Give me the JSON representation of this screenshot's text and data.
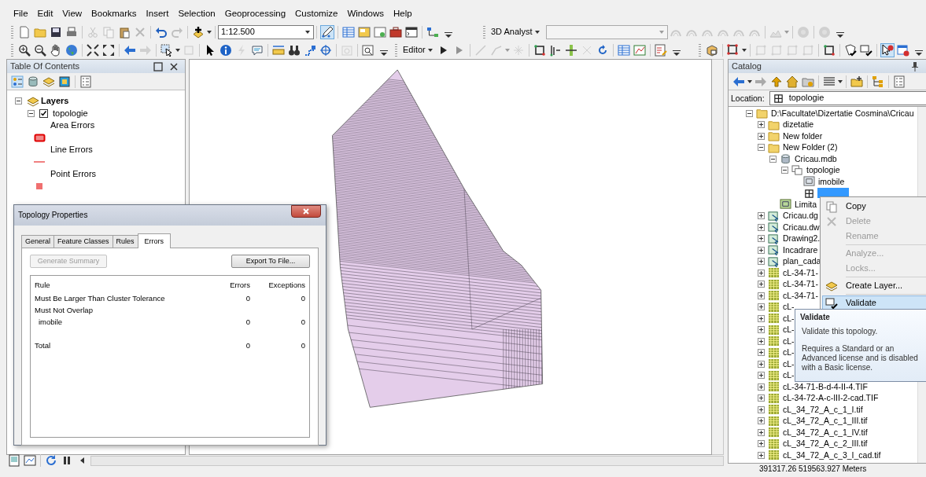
{
  "menu": [
    {
      "label": "File"
    },
    {
      "label": "Edit"
    },
    {
      "label": "View"
    },
    {
      "label": "Bookmarks"
    },
    {
      "label": "Insert"
    },
    {
      "label": "Selection"
    },
    {
      "label": "Geoprocessing"
    },
    {
      "label": "Customize"
    },
    {
      "label": "Windows"
    },
    {
      "label": "Help"
    }
  ],
  "toolbar": {
    "scale": "1:12.500",
    "analyst_label": "3D Analyst",
    "editor_label": "Editor"
  },
  "toc": {
    "title": "Table Of Contents",
    "tree": [
      {
        "label": "Layers",
        "kind": "frame",
        "expanded": true,
        "children": [
          {
            "label": "topologie",
            "kind": "layer",
            "expanded": true,
            "checked": true,
            "children": [
              {
                "label": "Area Errors",
                "kind": "area"
              },
              {
                "label": "Line Errors",
                "kind": "line"
              },
              {
                "label": "Point Errors",
                "kind": "point"
              }
            ]
          }
        ]
      }
    ]
  },
  "dialog": {
    "title": "Topology Properties",
    "tabs": [
      {
        "label": "General",
        "selected": false
      },
      {
        "label": "Feature Classes",
        "selected": false
      },
      {
        "label": "Rules",
        "selected": false
      },
      {
        "label": "Errors",
        "selected": true
      }
    ],
    "buttons": [
      {
        "label": "Generate Summary",
        "disabled": true
      },
      {
        "label": "Export To File...",
        "disabled": false
      }
    ],
    "table": {
      "columns": [
        "Rule",
        "Errors",
        "Exceptions"
      ],
      "rows": [
        {
          "kind": "rule",
          "rule": "Must Be Larger Than Cluster Tolerance",
          "errors": "0",
          "exceptions": "0"
        },
        {
          "kind": "rule",
          "rule": "Must Not Overlap"
        },
        {
          "kind": "feature",
          "rule": "imobile",
          "errors": "0",
          "exceptions": "0"
        },
        {
          "kind": "total",
          "rule": "Total",
          "errors": "0",
          "exceptions": "0"
        }
      ]
    }
  },
  "catalog": {
    "title": "Catalog",
    "location_label": "Location:",
    "location_value": "topologie",
    "tree": [
      {
        "label": "D:\\Facultate\\Dizertatie Cosmina\\Cricau",
        "kind": "folder",
        "expanded": true,
        "selected": false,
        "children": [
          {
            "label": "dizetatie",
            "kind": "folder",
            "expanded": false,
            "selected": false
          },
          {
            "label": "New folder",
            "kind": "folder",
            "expanded": false,
            "selected": false
          },
          {
            "label": "New Folder (2)",
            "kind": "folder",
            "expanded": true,
            "selected": false,
            "children": [
              {
                "label": "Cricau.mdb",
                "kind": "database",
                "expanded": true,
                "selected": false,
                "children": [
                  {
                    "label": "topologie",
                    "kind": "dataset",
                    "expanded": true,
                    "selected": false,
                    "children": [
                      {
                        "label": "imobile",
                        "kind": "feature_class",
                        "selected": false
                      },
                      {
                        "kind": "topology",
                        "selected": true
                      }
                    ]
                  }
                ]
              },
              {
                "label": "Limita",
                "kind": "shapefile",
                "selected": false
              }
            ]
          },
          {
            "label": "Cricau.dg",
            "kind": "cad",
            "expanded": false,
            "selected": false
          },
          {
            "label": "Cricau.dw",
            "kind": "cad",
            "expanded": false,
            "selected": false
          },
          {
            "label": "Drawing2.",
            "kind": "cad",
            "expanded": false,
            "selected": false
          },
          {
            "label": "Incadrare",
            "kind": "cad",
            "expanded": false,
            "selected": false
          },
          {
            "label": "plan_cada",
            "kind": "cad",
            "expanded": false,
            "selected": false
          },
          {
            "label": "cL-34-71-",
            "kind": "raster",
            "expanded": false,
            "selected": false
          },
          {
            "label": "cL-34-71-",
            "kind": "raster",
            "expanded": false,
            "selected": false
          },
          {
            "label": "cL-34-71-",
            "kind": "raster",
            "expanded": false,
            "selected": false
          },
          {
            "label": "cL-",
            "kind": "raster",
            "expanded": false,
            "selected": false
          },
          {
            "label": "cL-",
            "kind": "raster",
            "expanded": false,
            "selected": false
          },
          {
            "label": "cL-",
            "kind": "raster",
            "expanded": false,
            "selected": false
          },
          {
            "label": "cL-",
            "kind": "raster",
            "expanded": false,
            "selected": false
          },
          {
            "label": "cL-",
            "kind": "raster",
            "expanded": false,
            "selected": false
          },
          {
            "label": "cL-",
            "kind": "raster",
            "expanded": false,
            "selected": false
          },
          {
            "label": "cL-",
            "kind": "raster",
            "expanded": false,
            "selected": false
          },
          {
            "label": "cL-34-71-B-d-4-II-4.TIF",
            "kind": "raster",
            "expanded": false,
            "selected": false
          },
          {
            "label": "cL-34-72-A-c-III-2-cad.TIF",
            "kind": "raster",
            "expanded": false,
            "selected": false
          },
          {
            "label": "cL_34_72_A_c_1_I.tif",
            "kind": "raster",
            "expanded": false,
            "selected": false
          },
          {
            "label": "cL_34_72_A_c_1_III.tif",
            "kind": "raster",
            "expanded": false,
            "selected": false
          },
          {
            "label": "cL_34_72_A_c_1_IV.tif",
            "kind": "raster",
            "expanded": false,
            "selected": false
          },
          {
            "label": "cL_34_72_A_c_2_III.tif",
            "kind": "raster",
            "expanded": false,
            "selected": false
          },
          {
            "label": "cL_34_72_A_c_3_I_cad.tif",
            "kind": "raster",
            "expanded": false,
            "selected": false
          }
        ]
      }
    ]
  },
  "context_menu": [
    {
      "label": "Copy",
      "kind": "copy",
      "disabled": false,
      "selected": false,
      "separator_before": false
    },
    {
      "label": "Delete",
      "kind": "delete",
      "disabled": true,
      "selected": false,
      "separator_before": false
    },
    {
      "label": "Rename",
      "kind": "none",
      "disabled": true,
      "selected": false,
      "separator_before": false
    },
    {
      "label": "Analyze...",
      "kind": "none",
      "disabled": true,
      "selected": false,
      "separator_before": true
    },
    {
      "label": "Locks...",
      "kind": "none",
      "disabled": true,
      "selected": false,
      "separator_before": false
    },
    {
      "label": "Create Layer...",
      "kind": "layer",
      "disabled": false,
      "selected": false,
      "separator_before": true
    },
    {
      "label": "Validate",
      "kind": "validate",
      "disabled": false,
      "selected": true,
      "separator_before": true
    }
  ],
  "tooltip": {
    "title": "Validate",
    "lines": [
      "Validate this topology.",
      "Requires a Standard or an Advanced license and is disabled with a Basic license."
    ]
  },
  "status_bar": {
    "coordinates": "391317.26 519563.927 Meters"
  }
}
